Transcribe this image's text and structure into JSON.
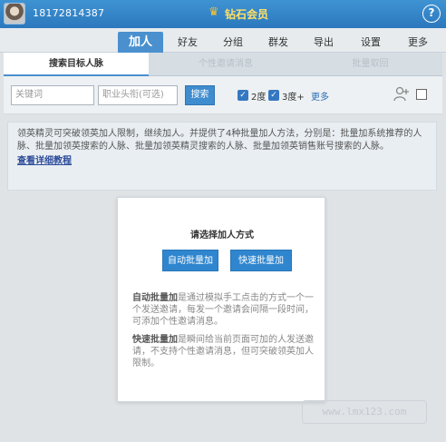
{
  "titlebar": {
    "phone": "18172814387",
    "vip_label": "钻石会员",
    "help": "?"
  },
  "nav": {
    "tabs": [
      {
        "label": "加人",
        "active": true
      },
      {
        "label": "好友"
      },
      {
        "label": "分组"
      },
      {
        "label": "群发"
      },
      {
        "label": "导出"
      },
      {
        "label": "设置"
      },
      {
        "label": "更多"
      }
    ]
  },
  "subtabs": [
    {
      "label": "搜索目标人脉",
      "active": true
    },
    {
      "label": "个性邀请消息"
    },
    {
      "label": "批量取回"
    }
  ],
  "search": {
    "keyword_placeholder": "关键词",
    "title_placeholder": "职业头衔(可选)",
    "button": "搜索",
    "degree2": "2度",
    "degree3": "3度+",
    "more": "更多"
  },
  "info": {
    "text": "领英精灵可突破领英加人限制，继续加人。并提供了4种批量加人方法，分别是：批量加系统推荐的人脉、批量加领英搜索的人脉、批量加领英精灵搜索的人脉、批量加领英销售账号搜索的人脉。",
    "link": "查看详细教程"
  },
  "dialog": {
    "title": "请选择加人方式",
    "auto_btn": "自动批量加",
    "fast_btn": "快速批量加",
    "auto_term": "自动批量加",
    "auto_desc": "是通过模拟手工点击的方式一个一个发送邀请，每发一个邀请会间隔一段时间，可添加个性邀请消息。",
    "fast_term": "快速批量加",
    "fast_desc": "是瞬间给当前页面可加的人发送邀请，不支持个性邀请消息，但可突破领英加人限制。"
  },
  "watermark": "www.lmx123.com",
  "colors": {
    "primary": "#2f86cf",
    "titlebar": "#3583c7",
    "link": "#2d4b9a"
  }
}
